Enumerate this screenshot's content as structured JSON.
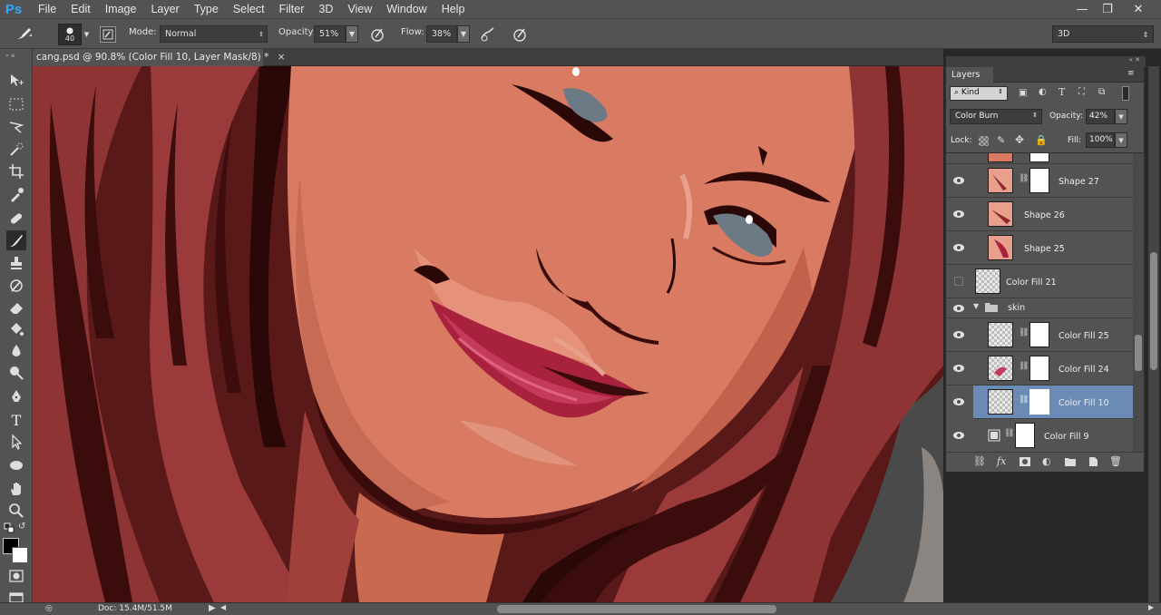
{
  "app": {
    "logo": "Ps"
  },
  "menu": [
    "File",
    "Edit",
    "Image",
    "Layer",
    "Type",
    "Select",
    "Filter",
    "3D",
    "View",
    "Window",
    "Help"
  ],
  "window_controls": {
    "minimize": "—",
    "restore": "❐",
    "close": "✕"
  },
  "options": {
    "brush_size": "40",
    "mode_label": "Mode:",
    "mode_value": "Normal",
    "opacity_label": "Opacity:",
    "opacity_value": "51%",
    "flow_label": "Flow:",
    "flow_value": "38%",
    "workspace": "3D"
  },
  "document": {
    "tab_title": "cang.psd @ 90.8% (Color Fill 10, Layer Mask/8) *",
    "tab_close": "×"
  },
  "status": {
    "doc": "Doc: 15.4M/51.5M"
  },
  "layers": {
    "panel_title": "Layers",
    "filter_kind": "Kind",
    "blend_mode": "Color Burn",
    "opacity_label": "Opacity:",
    "opacity_value": "42%",
    "lock_label": "Lock:",
    "fill_label": "Fill:",
    "fill_value": "100%",
    "items": [
      {
        "name": "Shape 27",
        "visible": true
      },
      {
        "name": "Shape 26",
        "visible": true
      },
      {
        "name": "Shape 25",
        "visible": true
      },
      {
        "name": "Color Fill 21",
        "visible": false
      },
      {
        "name": "skin",
        "visible": true,
        "group": true
      },
      {
        "name": "Color Fill 25",
        "visible": true
      },
      {
        "name": "Color Fill 24",
        "visible": true
      },
      {
        "name": "Color Fill 10",
        "visible": true,
        "selected": true
      },
      {
        "name": "Color Fill 9",
        "visible": true
      }
    ],
    "footer_icons": [
      "link-icon",
      "fx-icon",
      "mask-icon",
      "adjustment-icon",
      "folder-icon",
      "new-layer-icon",
      "trash-icon"
    ]
  },
  "colors": {
    "ui_bg": "#535353",
    "panel_dark": "#3d3d3d",
    "selection": "#6a8bb5",
    "accent": "#31a8ff",
    "skin": "#d87a62",
    "hair": "#8e3232",
    "lips": "#a8223e"
  }
}
